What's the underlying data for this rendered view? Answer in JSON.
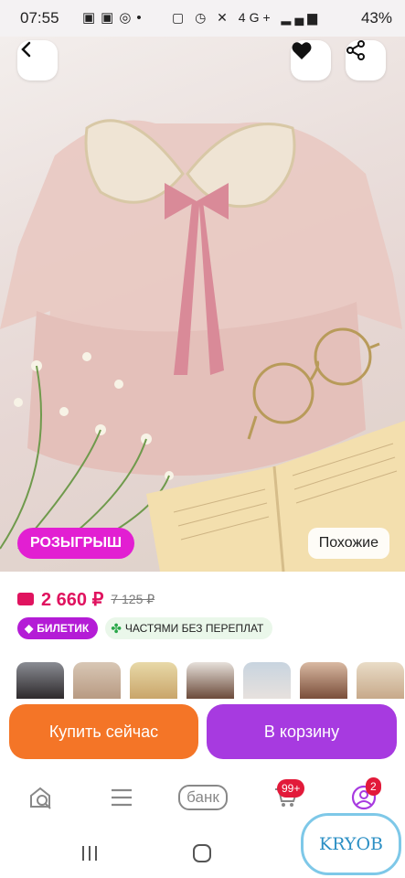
{
  "status_bar": {
    "time": "07:55",
    "battery": "43%",
    "network": "4G+"
  },
  "hero": {
    "back_icon": "back-arrow-icon",
    "favorite_icon": "heart-icon",
    "share_icon": "share-icon",
    "raffle_label": "РОЗЫГРЫШ",
    "similar_label": "Похожие"
  },
  "product": {
    "price": "2 660 ₽",
    "old_price": "7 125 ₽",
    "badge_ticket": "БИЛЕТИК",
    "badge_installments": "ЧАСТЯМИ БЕЗ ПЕРЕПЛАТ"
  },
  "actions": {
    "buy_now": "Купить сейчас",
    "add_to_cart": "В корзину"
  },
  "bottom_nav": {
    "search_icon": "search-home-icon",
    "catalog_icon": "menu-icon",
    "bank_label": "банк",
    "cart_badge": "99+",
    "profile_badge": "2"
  },
  "watermark": "KRYOB",
  "colors": {
    "accent_pink": "#e0135f",
    "raffle_magenta": "#e21fd2",
    "buy_orange": "#f47527",
    "cart_purple": "#a73ae0"
  }
}
